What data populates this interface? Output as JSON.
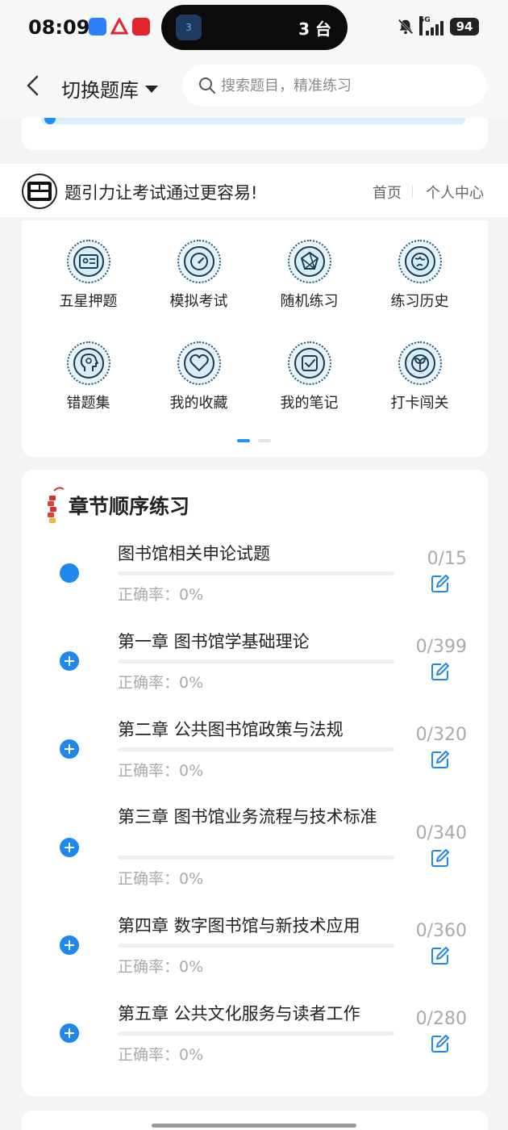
{
  "status_bar": {
    "time": "08:09",
    "island_label": "3 台",
    "island_badge": "3",
    "network": "5G",
    "battery": "94"
  },
  "header": {
    "switch_label": "切换题库",
    "search_placeholder": "搜索题目，精准练习"
  },
  "brand": {
    "slogan": "题引力让考试通过更容易!",
    "nav_home": "首页",
    "nav_center": "个人中心"
  },
  "grid": [
    {
      "label": "五星押题",
      "icon": "id-card-icon"
    },
    {
      "label": "模拟考试",
      "icon": "speedometer-icon"
    },
    {
      "label": "随机练习",
      "icon": "random-network-icon"
    },
    {
      "label": "练习历史",
      "icon": "globe-history-icon"
    },
    {
      "label": "错题集",
      "icon": "head-profile-icon"
    },
    {
      "label": "我的收藏",
      "icon": "heart-icon"
    },
    {
      "label": "我的笔记",
      "icon": "note-check-icon"
    },
    {
      "label": "打卡闯关",
      "icon": "sprout-icon"
    }
  ],
  "chapters": {
    "title": "章节顺序练习",
    "accuracy_prefix": "正确率：",
    "items": [
      {
        "title": "图书馆相关申论试题",
        "count": "0/15",
        "accuracy": "0%",
        "progress": 0,
        "expanded": true
      },
      {
        "title": "第一章 图书馆学基础理论",
        "count": "0/399",
        "accuracy": "0%",
        "progress": 0,
        "expanded": false
      },
      {
        "title": "第二章 公共图书馆政策与法规",
        "count": "0/320",
        "accuracy": "0%",
        "progress": 0,
        "expanded": false
      },
      {
        "title": "第三章 图书馆业务流程与技术标准",
        "count": "0/340",
        "accuracy": "0%",
        "progress": 0,
        "expanded": false
      },
      {
        "title": "第四章 数字图书馆与新技术应用",
        "count": "0/360",
        "accuracy": "0%",
        "progress": 0,
        "expanded": false
      },
      {
        "title": "第五章 公共文化服务与读者工作",
        "count": "0/280",
        "accuracy": "0%",
        "progress": 0,
        "expanded": false
      }
    ]
  },
  "colors": {
    "accent": "#1e88f0",
    "page_bg": "#f3f4f6",
    "muted_text": "#aaaaaa"
  }
}
